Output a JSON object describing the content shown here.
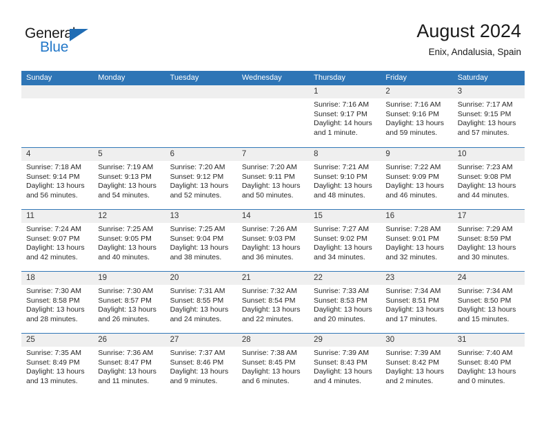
{
  "brand": {
    "name_part1": "General",
    "name_part2": "Blue",
    "flag_icon": "flag-triangle-icon",
    "accent_color": "#2277c8"
  },
  "header": {
    "month_title": "August 2024",
    "location": "Enix, Andalusia, Spain",
    "header_bg_color": "#2e75b6",
    "day_band_color": "#efefef"
  },
  "weekday_headers": [
    "Sunday",
    "Monday",
    "Tuesday",
    "Wednesday",
    "Thursday",
    "Friday",
    "Saturday"
  ],
  "weeks": [
    [
      {
        "day": "",
        "empty": true,
        "sunrise": "",
        "sunset": "",
        "daylight_line1": "",
        "daylight_line2": ""
      },
      {
        "day": "",
        "empty": true,
        "sunrise": "",
        "sunset": "",
        "daylight_line1": "",
        "daylight_line2": ""
      },
      {
        "day": "",
        "empty": true,
        "sunrise": "",
        "sunset": "",
        "daylight_line1": "",
        "daylight_line2": ""
      },
      {
        "day": "",
        "empty": true,
        "sunrise": "",
        "sunset": "",
        "daylight_line1": "",
        "daylight_line2": ""
      },
      {
        "day": "1",
        "empty": false,
        "sunrise": "Sunrise: 7:16 AM",
        "sunset": "Sunset: 9:17 PM",
        "daylight_line1": "Daylight: 14 hours",
        "daylight_line2": "and 1 minute."
      },
      {
        "day": "2",
        "empty": false,
        "sunrise": "Sunrise: 7:16 AM",
        "sunset": "Sunset: 9:16 PM",
        "daylight_line1": "Daylight: 13 hours",
        "daylight_line2": "and 59 minutes."
      },
      {
        "day": "3",
        "empty": false,
        "sunrise": "Sunrise: 7:17 AM",
        "sunset": "Sunset: 9:15 PM",
        "daylight_line1": "Daylight: 13 hours",
        "daylight_line2": "and 57 minutes."
      }
    ],
    [
      {
        "day": "4",
        "empty": false,
        "sunrise": "Sunrise: 7:18 AM",
        "sunset": "Sunset: 9:14 PM",
        "daylight_line1": "Daylight: 13 hours",
        "daylight_line2": "and 56 minutes."
      },
      {
        "day": "5",
        "empty": false,
        "sunrise": "Sunrise: 7:19 AM",
        "sunset": "Sunset: 9:13 PM",
        "daylight_line1": "Daylight: 13 hours",
        "daylight_line2": "and 54 minutes."
      },
      {
        "day": "6",
        "empty": false,
        "sunrise": "Sunrise: 7:20 AM",
        "sunset": "Sunset: 9:12 PM",
        "daylight_line1": "Daylight: 13 hours",
        "daylight_line2": "and 52 minutes."
      },
      {
        "day": "7",
        "empty": false,
        "sunrise": "Sunrise: 7:20 AM",
        "sunset": "Sunset: 9:11 PM",
        "daylight_line1": "Daylight: 13 hours",
        "daylight_line2": "and 50 minutes."
      },
      {
        "day": "8",
        "empty": false,
        "sunrise": "Sunrise: 7:21 AM",
        "sunset": "Sunset: 9:10 PM",
        "daylight_line1": "Daylight: 13 hours",
        "daylight_line2": "and 48 minutes."
      },
      {
        "day": "9",
        "empty": false,
        "sunrise": "Sunrise: 7:22 AM",
        "sunset": "Sunset: 9:09 PM",
        "daylight_line1": "Daylight: 13 hours",
        "daylight_line2": "and 46 minutes."
      },
      {
        "day": "10",
        "empty": false,
        "sunrise": "Sunrise: 7:23 AM",
        "sunset": "Sunset: 9:08 PM",
        "daylight_line1": "Daylight: 13 hours",
        "daylight_line2": "and 44 minutes."
      }
    ],
    [
      {
        "day": "11",
        "empty": false,
        "sunrise": "Sunrise: 7:24 AM",
        "sunset": "Sunset: 9:07 PM",
        "daylight_line1": "Daylight: 13 hours",
        "daylight_line2": "and 42 minutes."
      },
      {
        "day": "12",
        "empty": false,
        "sunrise": "Sunrise: 7:25 AM",
        "sunset": "Sunset: 9:05 PM",
        "daylight_line1": "Daylight: 13 hours",
        "daylight_line2": "and 40 minutes."
      },
      {
        "day": "13",
        "empty": false,
        "sunrise": "Sunrise: 7:25 AM",
        "sunset": "Sunset: 9:04 PM",
        "daylight_line1": "Daylight: 13 hours",
        "daylight_line2": "and 38 minutes."
      },
      {
        "day": "14",
        "empty": false,
        "sunrise": "Sunrise: 7:26 AM",
        "sunset": "Sunset: 9:03 PM",
        "daylight_line1": "Daylight: 13 hours",
        "daylight_line2": "and 36 minutes."
      },
      {
        "day": "15",
        "empty": false,
        "sunrise": "Sunrise: 7:27 AM",
        "sunset": "Sunset: 9:02 PM",
        "daylight_line1": "Daylight: 13 hours",
        "daylight_line2": "and 34 minutes."
      },
      {
        "day": "16",
        "empty": false,
        "sunrise": "Sunrise: 7:28 AM",
        "sunset": "Sunset: 9:01 PM",
        "daylight_line1": "Daylight: 13 hours",
        "daylight_line2": "and 32 minutes."
      },
      {
        "day": "17",
        "empty": false,
        "sunrise": "Sunrise: 7:29 AM",
        "sunset": "Sunset: 8:59 PM",
        "daylight_line1": "Daylight: 13 hours",
        "daylight_line2": "and 30 minutes."
      }
    ],
    [
      {
        "day": "18",
        "empty": false,
        "sunrise": "Sunrise: 7:30 AM",
        "sunset": "Sunset: 8:58 PM",
        "daylight_line1": "Daylight: 13 hours",
        "daylight_line2": "and 28 minutes."
      },
      {
        "day": "19",
        "empty": false,
        "sunrise": "Sunrise: 7:30 AM",
        "sunset": "Sunset: 8:57 PM",
        "daylight_line1": "Daylight: 13 hours",
        "daylight_line2": "and 26 minutes."
      },
      {
        "day": "20",
        "empty": false,
        "sunrise": "Sunrise: 7:31 AM",
        "sunset": "Sunset: 8:55 PM",
        "daylight_line1": "Daylight: 13 hours",
        "daylight_line2": "and 24 minutes."
      },
      {
        "day": "21",
        "empty": false,
        "sunrise": "Sunrise: 7:32 AM",
        "sunset": "Sunset: 8:54 PM",
        "daylight_line1": "Daylight: 13 hours",
        "daylight_line2": "and 22 minutes."
      },
      {
        "day": "22",
        "empty": false,
        "sunrise": "Sunrise: 7:33 AM",
        "sunset": "Sunset: 8:53 PM",
        "daylight_line1": "Daylight: 13 hours",
        "daylight_line2": "and 20 minutes."
      },
      {
        "day": "23",
        "empty": false,
        "sunrise": "Sunrise: 7:34 AM",
        "sunset": "Sunset: 8:51 PM",
        "daylight_line1": "Daylight: 13 hours",
        "daylight_line2": "and 17 minutes."
      },
      {
        "day": "24",
        "empty": false,
        "sunrise": "Sunrise: 7:34 AM",
        "sunset": "Sunset: 8:50 PM",
        "daylight_line1": "Daylight: 13 hours",
        "daylight_line2": "and 15 minutes."
      }
    ],
    [
      {
        "day": "25",
        "empty": false,
        "sunrise": "Sunrise: 7:35 AM",
        "sunset": "Sunset: 8:49 PM",
        "daylight_line1": "Daylight: 13 hours",
        "daylight_line2": "and 13 minutes."
      },
      {
        "day": "26",
        "empty": false,
        "sunrise": "Sunrise: 7:36 AM",
        "sunset": "Sunset: 8:47 PM",
        "daylight_line1": "Daylight: 13 hours",
        "daylight_line2": "and 11 minutes."
      },
      {
        "day": "27",
        "empty": false,
        "sunrise": "Sunrise: 7:37 AM",
        "sunset": "Sunset: 8:46 PM",
        "daylight_line1": "Daylight: 13 hours",
        "daylight_line2": "and 9 minutes."
      },
      {
        "day": "28",
        "empty": false,
        "sunrise": "Sunrise: 7:38 AM",
        "sunset": "Sunset: 8:45 PM",
        "daylight_line1": "Daylight: 13 hours",
        "daylight_line2": "and 6 minutes."
      },
      {
        "day": "29",
        "empty": false,
        "sunrise": "Sunrise: 7:39 AM",
        "sunset": "Sunset: 8:43 PM",
        "daylight_line1": "Daylight: 13 hours",
        "daylight_line2": "and 4 minutes."
      },
      {
        "day": "30",
        "empty": false,
        "sunrise": "Sunrise: 7:39 AM",
        "sunset": "Sunset: 8:42 PM",
        "daylight_line1": "Daylight: 13 hours",
        "daylight_line2": "and 2 minutes."
      },
      {
        "day": "31",
        "empty": false,
        "sunrise": "Sunrise: 7:40 AM",
        "sunset": "Sunset: 8:40 PM",
        "daylight_line1": "Daylight: 13 hours",
        "daylight_line2": "and 0 minutes."
      }
    ]
  ]
}
